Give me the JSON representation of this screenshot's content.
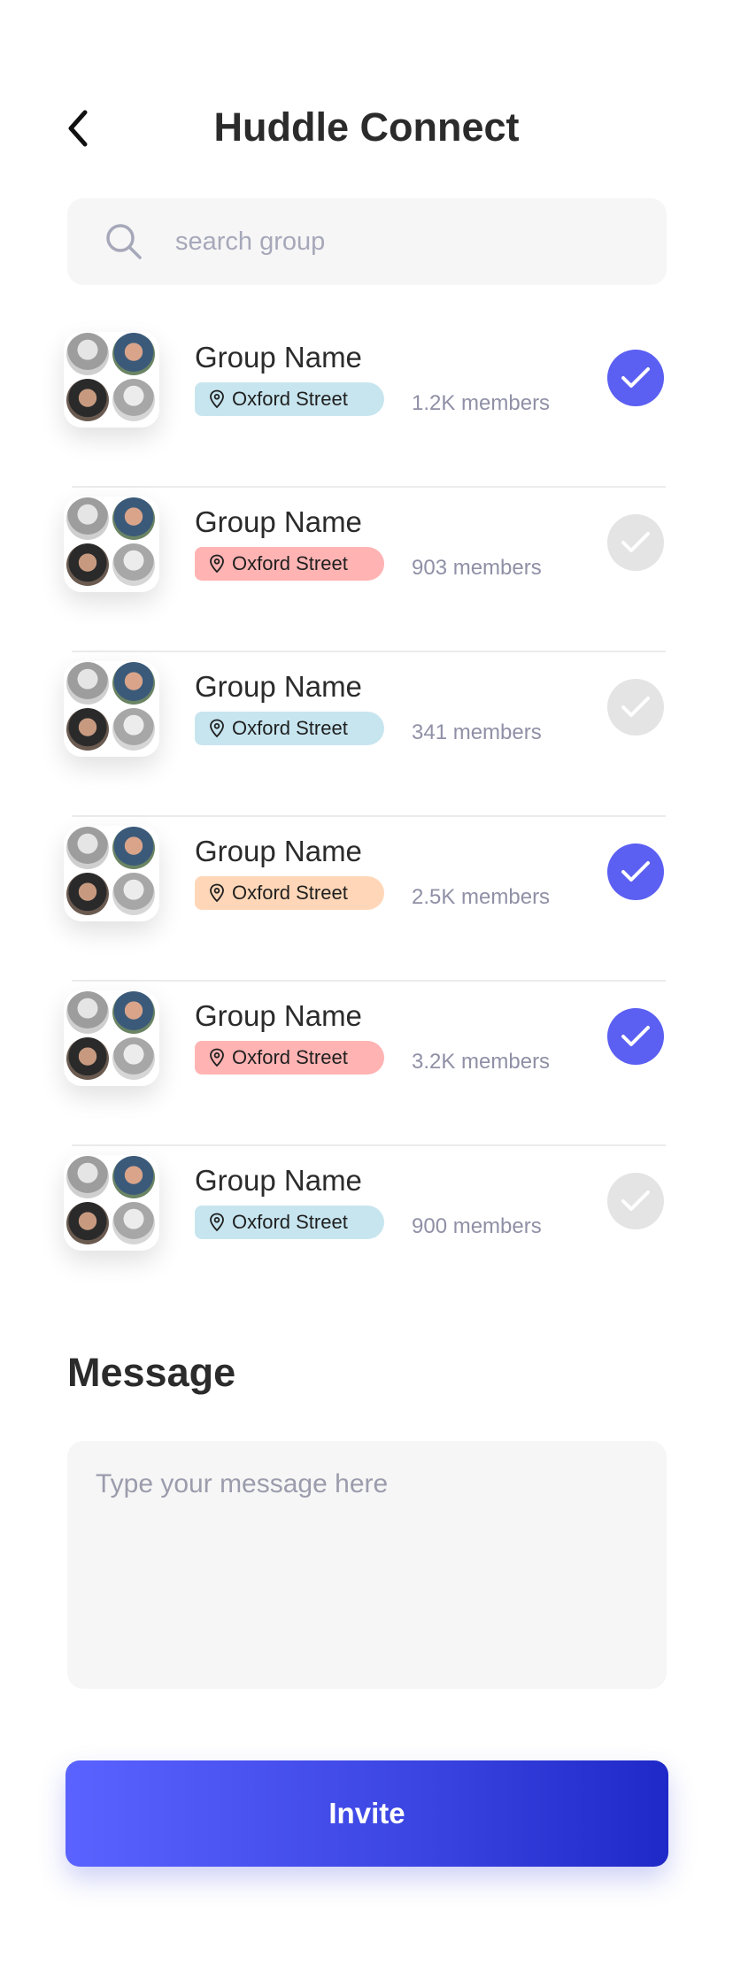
{
  "header": {
    "title": "Huddle Connect"
  },
  "search": {
    "placeholder": "search group"
  },
  "groups": [
    {
      "name": "Group Name",
      "location": "Oxford Street",
      "tag_color": "#c7e5ef",
      "members": "1.2K members",
      "selected": true
    },
    {
      "name": "Group Name",
      "location": "Oxford Street",
      "tag_color": "#ffb3b3",
      "members": "903 members",
      "selected": false
    },
    {
      "name": "Group Name",
      "location": "Oxford Street",
      "tag_color": "#c7e5ef",
      "members": "341 members",
      "selected": false
    },
    {
      "name": "Group Name",
      "location": "Oxford Street",
      "tag_color": "#ffd7b8",
      "members": "2.5K members",
      "selected": true
    },
    {
      "name": "Group Name",
      "location": "Oxford Street",
      "tag_color": "#ffb3b3",
      "members": "3.2K members",
      "selected": true
    },
    {
      "name": "Group Name",
      "location": "Oxford Street",
      "tag_color": "#c7e5ef",
      "members": "900 members",
      "selected": false
    }
  ],
  "message": {
    "title": "Message",
    "placeholder": "Type your message here"
  },
  "invite": {
    "label": "Invite"
  },
  "colors": {
    "accent": "#5b5ff2",
    "unselected": "#e4e4e4",
    "button_gradient_start": "#5a62ff",
    "button_gradient_end": "#1f29c8"
  },
  "icons": {
    "back": "chevron-left-icon",
    "search": "search-icon",
    "location": "location-pin-icon",
    "check": "check-icon"
  }
}
